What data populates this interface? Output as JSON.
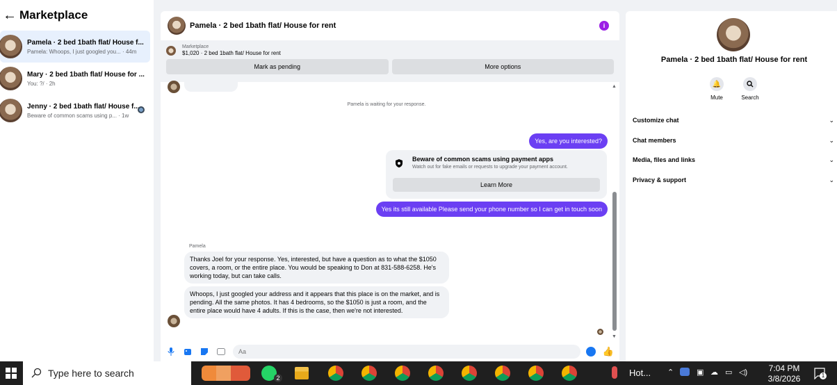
{
  "sidebar": {
    "back_icon": "←",
    "title": "Marketplace",
    "conversations": [
      {
        "name": "Pamela · 2 bed 1bath flat/ House f...",
        "preview": "Pamela: Whoops, I just googled you... · 44m",
        "active": true
      },
      {
        "name": "Mary · 2 bed 1bath flat/ House for ...",
        "preview": "You: ?/ · 2h",
        "active": false
      },
      {
        "name": "Jenny · 2 bed 1bath flat/ House f...",
        "preview": "Beware of common scams using p... · 1w",
        "active": false
      }
    ]
  },
  "chat": {
    "title": "Pamela · 2 bed 1bath flat/ House for rent",
    "marketplace_label": "Marketplace",
    "listing": "$1,020 · 2 bed 1bath flat/ House for rent",
    "mark_pending": "Mark as pending",
    "more_options": "More options",
    "waiting": "Pamela is waiting for your response.",
    "out_msg_1": "Yes, are you interested?",
    "scam_title": "Beware of common scams using payment apps",
    "scam_sub": "Watch out for fake emails or requests to upgrade your payment account.",
    "learn_more": "Learn More",
    "out_msg_2": "Yes its still available Please send your phone number so I can get in touch soon",
    "sender": "Pamela",
    "in_msg_1": "Thanks Joel for your response.  Yes, interested, but have a question as to what the $1050 covers, a room, or the entire place.  You would be speaking to Don at 831-588-6258.  He's working today, but can take calls.",
    "in_msg_2": "Whoops, I just googled your address and it appears that this place is on the market, and is pending.  All the same photos.  It has 4 bedrooms, so the $1050 is just a room, and the entire place would have 4 adults.  If this is the case, then we're not interested.",
    "composer_placeholder": "Aa"
  },
  "right": {
    "title": "Pamela · 2 bed 1bath flat/ House for rent",
    "mute": "Mute",
    "search": "Search",
    "items": [
      "Customize chat",
      "Chat members",
      "Media, files and links",
      "Privacy & support"
    ]
  },
  "taskbar": {
    "search_placeholder": "Type here to search",
    "whatsapp_badge": "2",
    "weather": "Hot...",
    "time": "7:04 PM",
    "date": "3/8/2026",
    "notifications": "1"
  },
  "colors": {
    "accent": "#6b3ff3",
    "info": "#9b1de5",
    "messenger_blue": "#1877f2"
  }
}
